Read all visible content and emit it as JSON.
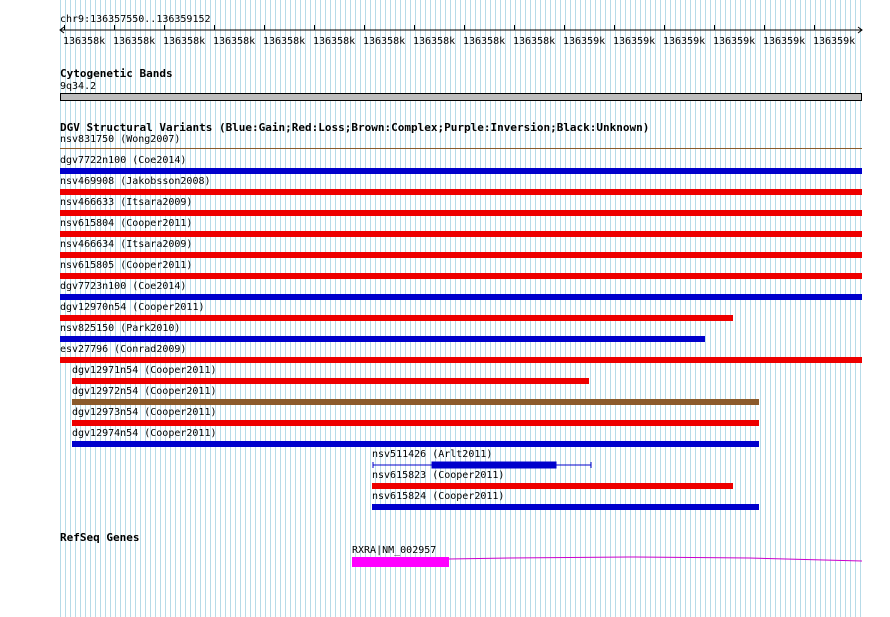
{
  "position_label": "chr9:136357550..136359152",
  "ruler": {
    "labels": [
      "136358k",
      "136358k",
      "136358k",
      "136358k",
      "136358k",
      "136358k",
      "136358k",
      "136358k",
      "136358k",
      "136358k",
      "136359k",
      "136359k",
      "136359k",
      "136359k",
      "136359k",
      "136359k"
    ]
  },
  "cytogenetic": {
    "title": "Cytogenetic Bands",
    "band": "9q34.2"
  },
  "dgv": {
    "title": "DGV Structural Variants (Blue:Gain;Red:Loss;Brown:Complex;Purple:Inversion;Black:Unknown)",
    "colors": {
      "gain": "#0000cc",
      "loss": "#ee0000",
      "complex": "#8b5a2b",
      "unknown": "#000000"
    },
    "variants": [
      {
        "label": "nsv831750 (Wong2007)",
        "type": "complex-line"
      },
      {
        "label": "dgv7722n100 (Coe2014)",
        "type": "gain"
      },
      {
        "label": "nsv469908 (Jakobsson2008)",
        "type": "loss"
      },
      {
        "label": "nsv466633 (Itsara2009)",
        "type": "loss"
      },
      {
        "label": "nsv615804 (Cooper2011)",
        "type": "loss"
      },
      {
        "label": "nsv466634 (Itsara2009)",
        "type": "loss"
      },
      {
        "label": "nsv615805 (Cooper2011)",
        "type": "loss"
      },
      {
        "label": "dgv7723n100 (Coe2014)",
        "type": "gain"
      },
      {
        "label": "dgv12970n54 (Cooper2011)",
        "type": "loss"
      },
      {
        "label": "nsv825150 (Park2010)",
        "type": "gain"
      },
      {
        "label": "esv27796 (Conrad2009)",
        "type": "loss"
      },
      {
        "label": "dgv12971n54 (Cooper2011)",
        "type": "loss"
      },
      {
        "label": "dgv12972n54 (Cooper2011)",
        "type": "complex"
      },
      {
        "label": "dgv12973n54 (Cooper2011)",
        "type": "loss"
      },
      {
        "label": "dgv12974n54 (Cooper2011)",
        "type": "gain"
      },
      {
        "label": "nsv511426 (Arlt2011)",
        "type": "gain-segmented"
      },
      {
        "label": "nsv615823 (Cooper2011)",
        "type": "loss"
      },
      {
        "label": "nsv615824 (Cooper2011)",
        "type": "gain"
      }
    ]
  },
  "refseq": {
    "title": "RefSeq Genes",
    "gene_label": "RXRA|NM_002957",
    "exon_color": "#ff00ff",
    "intron_color": "#cc00cc"
  }
}
